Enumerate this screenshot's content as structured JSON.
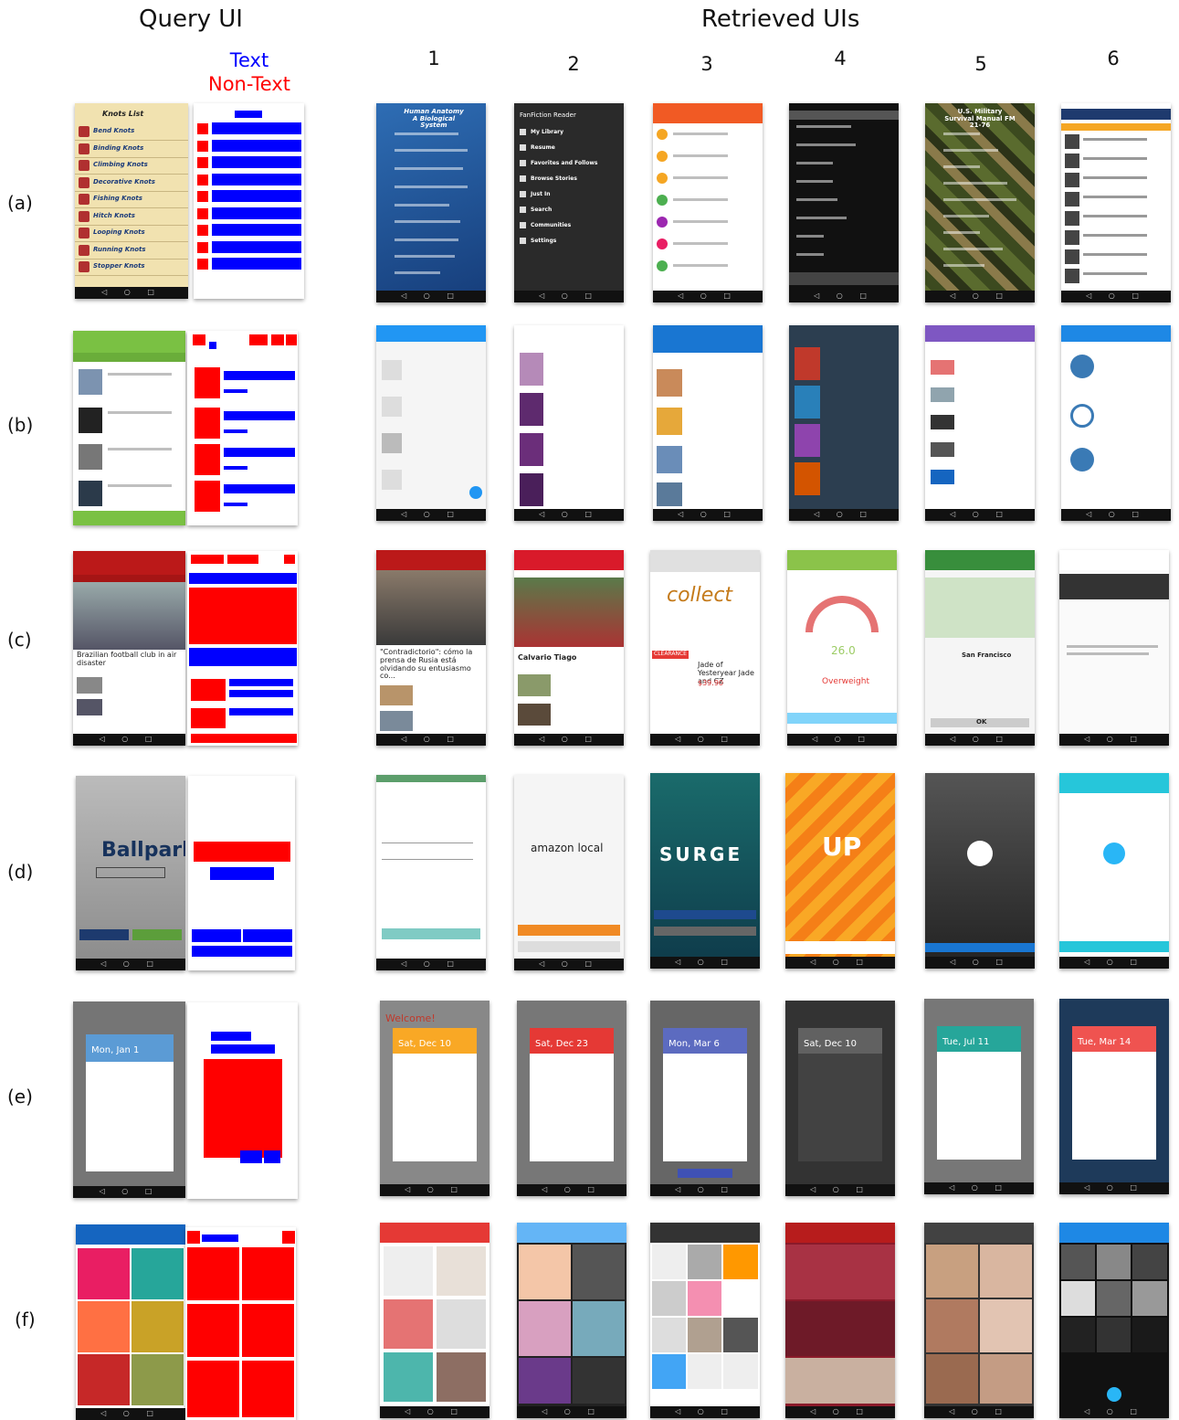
{
  "headers": {
    "query": "Query UI",
    "retrieved": "Retrieved UIs"
  },
  "legend": {
    "text": "Text",
    "non_text": "Non-Text",
    "text_color": "#0000ff",
    "non_text_color": "#ff0000"
  },
  "columns": [
    "1",
    "2",
    "3",
    "4",
    "5",
    "6"
  ],
  "rows": [
    "(a)",
    "(b)",
    "(c)",
    "(d)",
    "(e)",
    "(f)"
  ],
  "screens": {
    "knots_title": "Knots List",
    "knots_items": [
      "Bend Knots",
      "Binding Knots",
      "Climbing Knots",
      "Decorative Knots",
      "Fishing Knots",
      "Hitch Knots",
      "Looping Knots",
      "Running Knots",
      "Stopper Knots"
    ],
    "anatomy_title": "Human Anatomy A Biological System",
    "fanfic_title": "FanFiction Reader",
    "fanfic_items": [
      "My Library",
      "Resume",
      "Favorites and Follows",
      "Browse Stories",
      "Just In",
      "Search",
      "Communities",
      "Settings"
    ],
    "military_title": "U.S. Military Survival Manual FM 21-76",
    "bbc_headline": "Brazilian football club in air disaster",
    "mundo_headline": "\"Contradictorio\": cómo la prensa de Rusia está olvidando su entusiasmo co...",
    "marca_headline": "Calvario Tiago",
    "collect_text": "collect",
    "jewel_name": "Jade of Yesteryear Jade and CZ",
    "jewel_price": "$39.90",
    "clearance": "CLEARANCE",
    "bmi_value": "26.0",
    "bmi_label": "Overweight",
    "sf_label": "San Francisco",
    "ok_label": "OK",
    "ballpark": "Ballpark",
    "amazon": "amazon local",
    "surge": "SURGE",
    "up": "UP",
    "dates": [
      "Mon, Jan 1",
      "Sat, Dec 10",
      "Sat, Dec 23",
      "Mon, Mar 6",
      "Sat, Dec 10",
      "Tue, Jul 11",
      "Tue, Mar 14"
    ],
    "welcome": "Welcome!"
  }
}
